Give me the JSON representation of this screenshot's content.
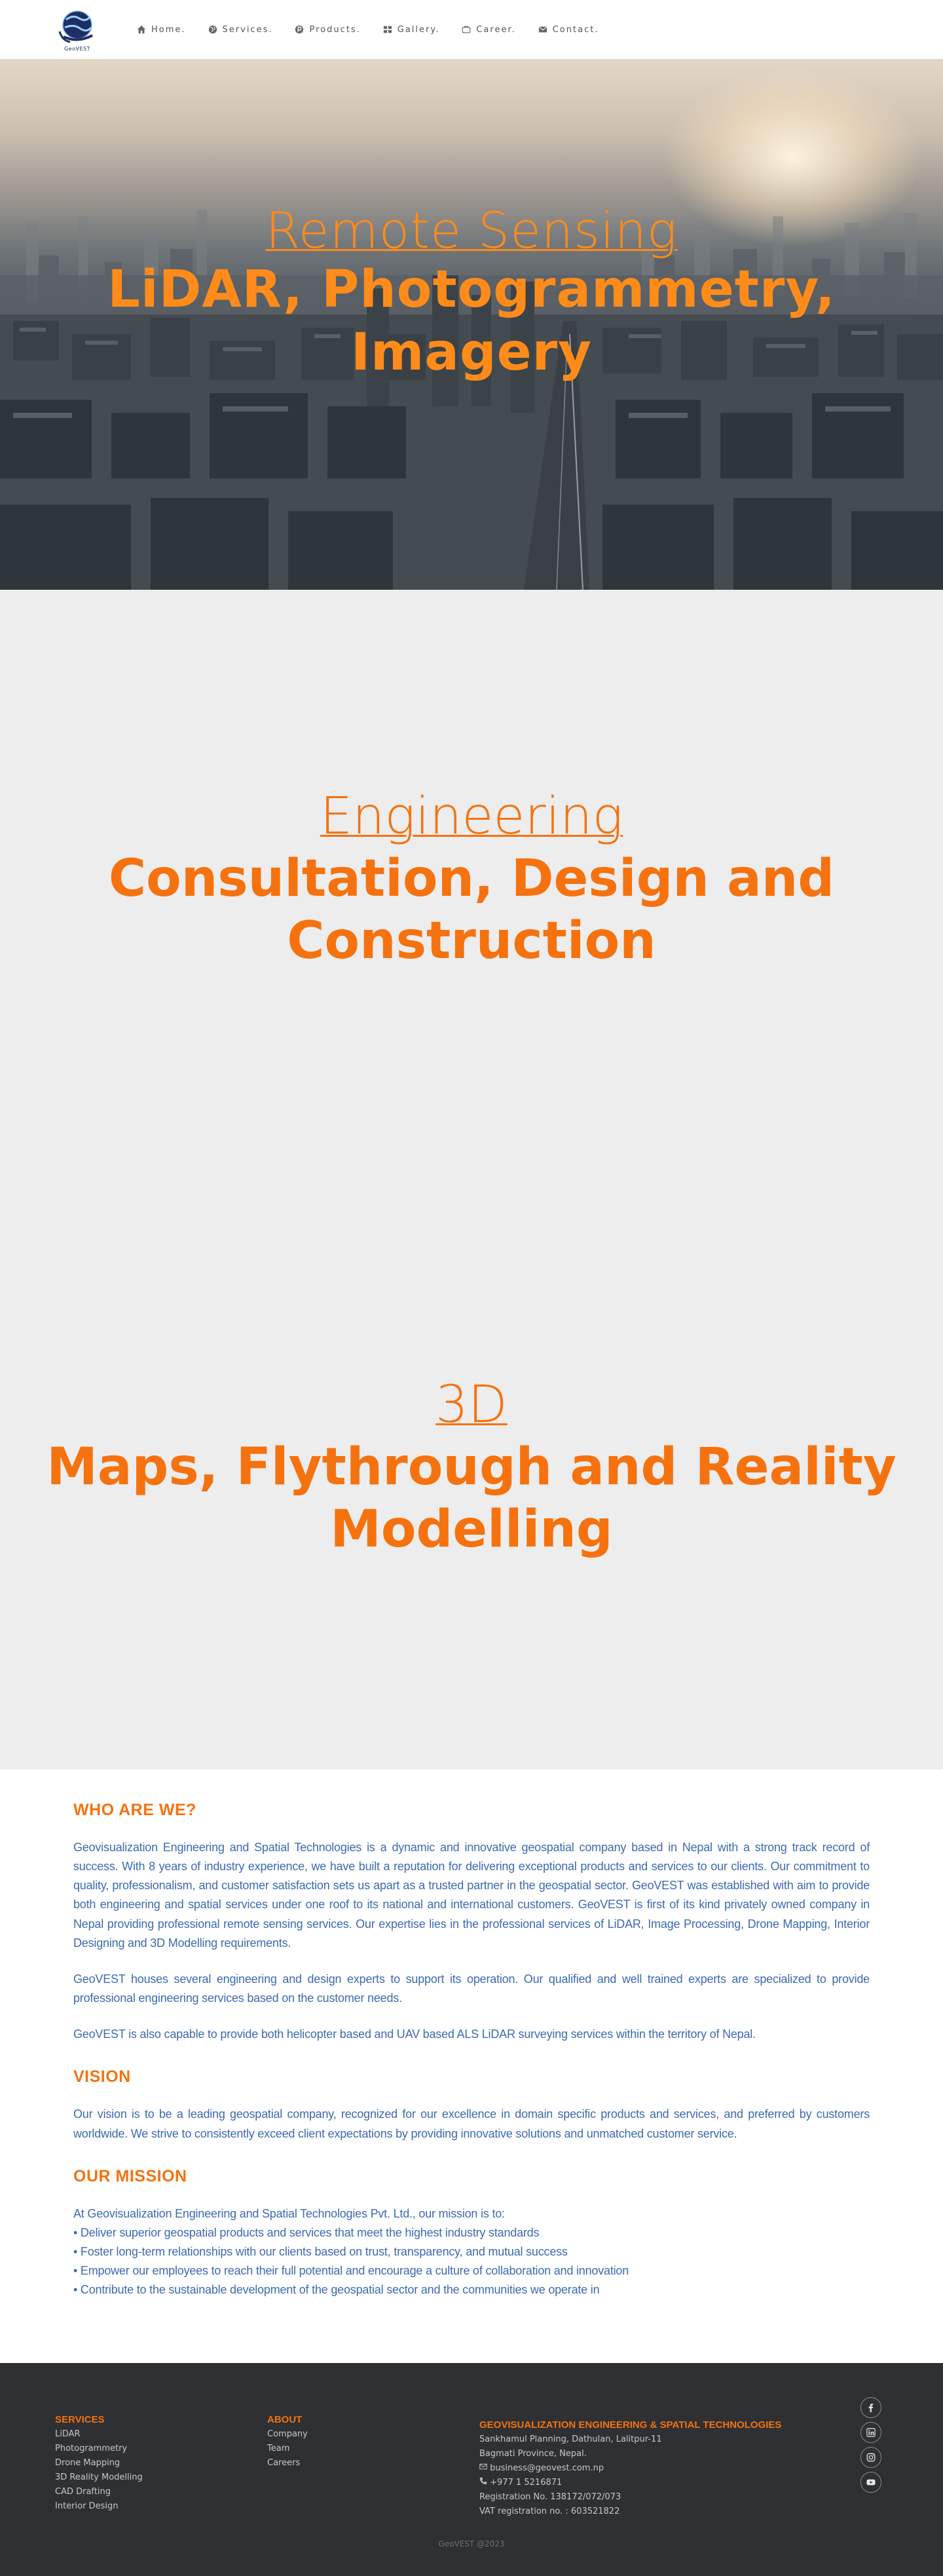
{
  "brand": {
    "logo_text": "GeoVEST"
  },
  "nav": [
    {
      "label": "Home.",
      "icon": "home-icon"
    },
    {
      "label": "Services.",
      "icon": "globe-icon"
    },
    {
      "label": "Products.",
      "icon": "product-icon"
    },
    {
      "label": "Gallery.",
      "icon": "grid-icon"
    },
    {
      "label": "Career.",
      "icon": "briefcase-icon"
    },
    {
      "label": "Contact.",
      "icon": "envelope-icon"
    }
  ],
  "hero": {
    "sub": "Remote Sensing",
    "main_line1": "LiDAR, Photogrammetry,",
    "main_line2": "Imagery"
  },
  "slides": [
    {
      "sub": "Engineering",
      "main_line1": "Consultation, Design and",
      "main_line2": "Construction"
    },
    {
      "sub": "3D",
      "main_line1": "Maps, Flythrough and Reality",
      "main_line2": "Modelling"
    }
  ],
  "about": {
    "who_title": "WHO ARE WE?",
    "who_p1": "Geovisualization Engineering and Spatial Technologies is a dynamic and innovative geospatial company based in Nepal with a strong track record of success. With 8 years of industry experience, we have built a reputation for delivering exceptional products and services to our clients. Our commitment to quality, professionalism, and customer satisfaction sets us apart as a trusted partner in the geospatial sector. GeoVEST was established with aim to provide both engineering and spatial services under one roof to its national and international customers. GeoVEST is first of its kind privately owned company in Nepal providing professional remote sensing services. Our expertise lies in the professional services of LiDAR, Image Processing, Drone Mapping, Interior Designing and 3D Modelling requirements.",
    "who_p2": "GeoVEST houses several engineering and design experts to support its operation. Our qualified and well trained experts are specialized to provide professional engineering services based on the customer needs.",
    "who_p3": "GeoVEST is also capable to provide both helicopter based and UAV based ALS LiDAR surveying services within the territory of Nepal.",
    "vision_title": "VISION",
    "vision_p": "Our vision is to be a leading geospatial company, recognized for our excellence in domain specific products and services, and preferred by customers worldwide. We strive to consistently exceed client expectations by providing innovative solutions and unmatched customer service.",
    "mission_title": "OUR MISSION",
    "mission_intro": "At Geovisualization Engineering and Spatial Technologies Pvt. Ltd., our mission is to:",
    "mission_items": [
      "• Deliver superior geospatial products and services that meet the highest industry standards",
      "• Foster long-term relationships with our clients based on trust, transparency, and mutual success",
      "• Empower our employees to reach their full potential and encourage a culture of collaboration and innovation",
      "• Contribute to the sustainable development of the geospatial sector and the communities we operate in"
    ]
  },
  "footer": {
    "services_title": "SERVICES",
    "services": [
      "LiDAR",
      "Photogrammetry",
      "Drone Mapping",
      "3D Reality Modelling",
      "CAD Drafting",
      "Interior Design"
    ],
    "about_title": "ABOUT",
    "about": [
      "Company",
      "Team",
      "Careers"
    ],
    "company_title": "GEOVISUALIZATION ENGINEERING & SPATIAL TECHNOLOGIES",
    "address1": "Sankhamul Planning, Dathulan, Lalitpur-11",
    "address2": "Bagmati Province, Nepal.",
    "email": "business@geovest.com.np",
    "phone": "+977 1 5216871",
    "registration": "Registration No. 138172/072/073",
    "vat": "VAT registration no. : 603521822",
    "social": [
      "facebook-icon",
      "linkedin-icon",
      "instagram-icon",
      "youtube-icon"
    ],
    "copyright": "GeoVEST @2023"
  },
  "colors": {
    "accent": "#f5720f",
    "body_text": "#3c6ab0",
    "footer_bg": "#2e3033",
    "grey_bg": "#ededed"
  }
}
